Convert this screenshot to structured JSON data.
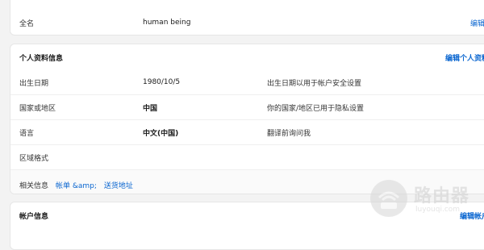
{
  "fullname_card": {
    "label": "全名",
    "value": "human being",
    "edit_link": "编辑"
  },
  "profile_card": {
    "title": "个人资料信息",
    "edit_link": "编辑个人资料",
    "rows": [
      {
        "label": "出生日期",
        "value": "1980/10/5",
        "desc": "出生日期以用于帐户安全设置"
      },
      {
        "label": "国家或地区",
        "value": "中国",
        "desc": "你的国家/地区已用于隐私设置"
      },
      {
        "label": "语言",
        "value": "中文(中国)",
        "desc": "翻译前询问我"
      },
      {
        "label": "区域格式",
        "value": "",
        "desc": ""
      }
    ],
    "related": {
      "label": "相关信息",
      "links": [
        "帐单 &amp;",
        "送货地址"
      ]
    }
  },
  "account_card": {
    "title": "帐户信息",
    "edit_link": "编辑帐户"
  },
  "watermark": {
    "text": "路由器",
    "sub": "luyouqi.com"
  }
}
